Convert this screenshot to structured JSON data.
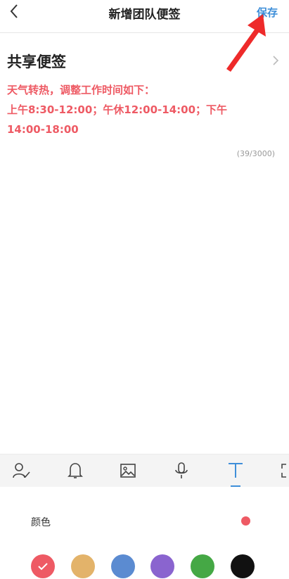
{
  "header": {
    "title": "新增团队便签",
    "save_label": "保存"
  },
  "note": {
    "title": "共享便签",
    "lines": [
      "天气转热，调整工作时间如下：",
      "上午8:30-12:00；午休12:00-14:00；下午",
      "14:00-18:00"
    ],
    "counter": "(39/3000)"
  },
  "toolbar": {
    "icons": [
      "assign-person-icon",
      "bell-icon",
      "image-icon",
      "microphone-icon",
      "text-format-icon",
      "fullscreen-icon"
    ],
    "active": "text-format-icon"
  },
  "color_panel": {
    "label": "颜色",
    "selected": "#ee5a64",
    "swatches": [
      "#ee5a64",
      "#e3b36a",
      "#5b8bd1",
      "#8a64cf",
      "#45a845",
      "#111111"
    ]
  },
  "colors": {
    "accent": "#3f8fd9",
    "text_red": "#ee5a64"
  }
}
